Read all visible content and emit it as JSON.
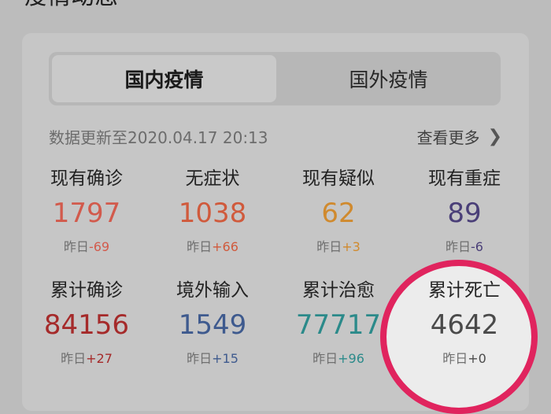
{
  "section_title": "疫情动态",
  "tabs": [
    {
      "label": "国内疫情",
      "active": true
    },
    {
      "label": "国外疫情",
      "active": false
    }
  ],
  "update_text": "数据更新至2020.04.17 20:13",
  "more_label": "查看更多",
  "delta_prefix": "昨日",
  "stats_row1": [
    {
      "label": "现有确诊",
      "value": "1797",
      "delta": "-69",
      "color": "#d25a4c",
      "delta_color": "#d25a4c"
    },
    {
      "label": "无症状",
      "value": "1038",
      "delta": "+66",
      "color": "#d05a3c",
      "delta_color": "#d05a3c"
    },
    {
      "label": "现有疑似",
      "value": "62",
      "delta": "+3",
      "color": "#d08a2e",
      "delta_color": "#d08a2e"
    },
    {
      "label": "现有重症",
      "value": "89",
      "delta": "-6",
      "color": "#4a3f78",
      "delta_color": "#4a3f78"
    }
  ],
  "stats_row2": [
    {
      "label": "累计确诊",
      "value": "84156",
      "delta": "+27",
      "color": "#a52a2a",
      "delta_color": "#a52a2a"
    },
    {
      "label": "境外输入",
      "value": "1549",
      "delta": "+15",
      "color": "#3e5a8e",
      "delta_color": "#3e5a8e"
    },
    {
      "label": "累计治愈",
      "value": "77717",
      "delta": "+96",
      "color": "#2b8a8a",
      "delta_color": "#2b8a8a"
    },
    {
      "label": "累计死亡",
      "value": "4642",
      "delta": "+0",
      "color": "#4a4a4a",
      "delta_color": "#4a4a4a"
    }
  ],
  "colors": {
    "highlight_ring": "#e0245e"
  }
}
